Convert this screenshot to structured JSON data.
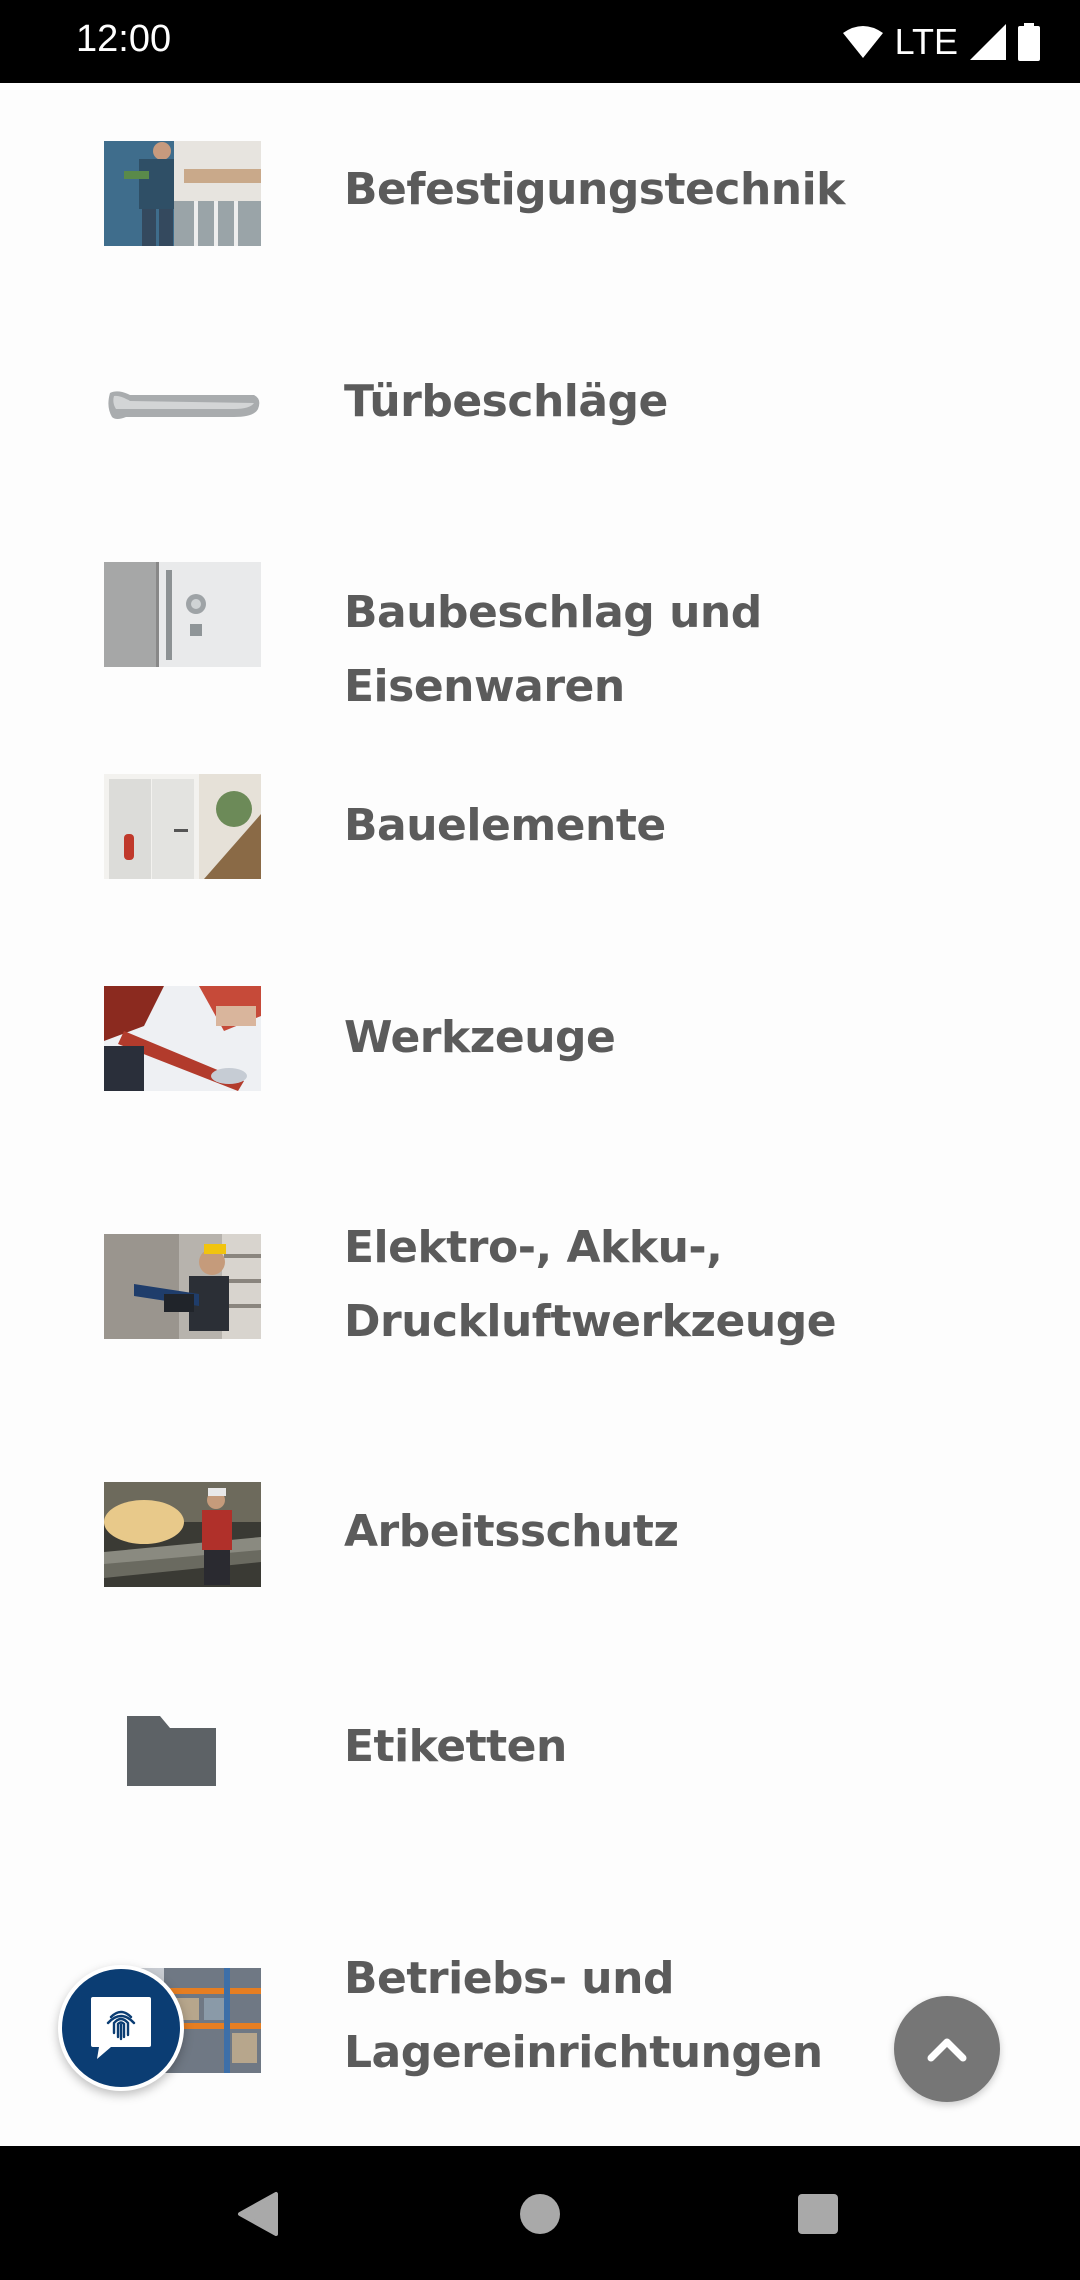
{
  "status_bar": {
    "time": "12:00",
    "network": "LTE",
    "icons": [
      "wifi-icon",
      "signal-icon",
      "battery-icon"
    ]
  },
  "categories": [
    {
      "label_lines": [
        "Befestigungstechnik"
      ],
      "image": "installer-photo"
    },
    {
      "label_lines": [
        "Türbeschläge"
      ],
      "image": "door-handle-photo"
    },
    {
      "label_lines": [
        "Baubeschlag und Eisenwaren"
      ],
      "image": "door-fittings-photo"
    },
    {
      "label_lines": [
        "Bauelemente"
      ],
      "image": "building-elements-photo"
    },
    {
      "label_lines": [
        "Werkzeuge"
      ],
      "image": "pipe-wrench-photo"
    },
    {
      "label_lines": [
        "Elektro-, Akku-,",
        "Druckluftwerkzeuge"
      ],
      "image": "power-tool-photo"
    },
    {
      "label_lines": [
        "Arbeitsschutz"
      ],
      "image": "safety-worker-photo"
    },
    {
      "label_lines": [
        "Etiketten"
      ],
      "image": "folder-icon"
    },
    {
      "label_lines": [
        "Betriebs- und",
        "Lagereinrichtungen"
      ],
      "image": "warehouse-photo"
    }
  ],
  "fab": {
    "chat_icon": "fingerprint-chat-icon",
    "scroll_top_icon": "chevron-up-icon"
  },
  "nav_bar": {
    "icons": [
      "back-icon",
      "home-icon",
      "recents-icon"
    ]
  },
  "colors": {
    "text": "#5b5b5b",
    "chat_fab": "#0b3d73",
    "scroll_fab": "#767676",
    "folder": "#5d6266"
  }
}
